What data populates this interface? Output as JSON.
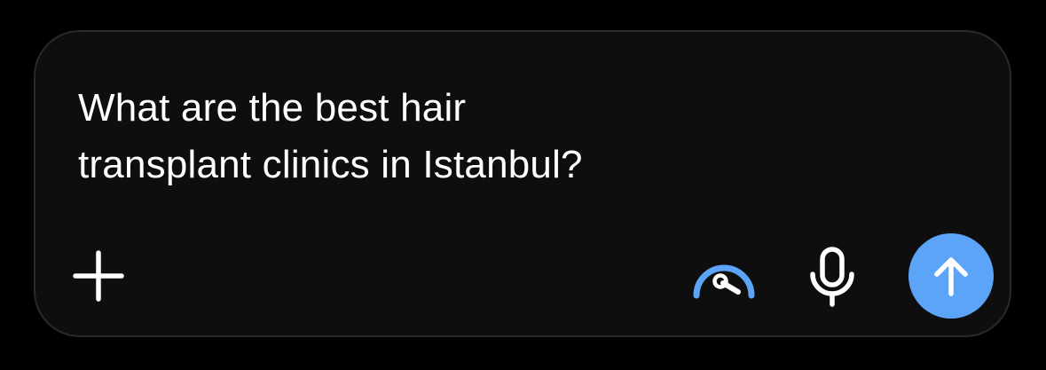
{
  "composer": {
    "prompt_text": "What are the best hair\ntransplant clinics in Istanbul?"
  },
  "toolbar": {
    "left_icon": "plus-icon",
    "right_icons": [
      "speedometer-icon",
      "microphone-icon",
      "arrow-up-icon"
    ]
  },
  "colors": {
    "background": "#000000",
    "composer_bg": "#0e0e0e",
    "text": "#ffffff",
    "accent": "#5ba4f8"
  }
}
